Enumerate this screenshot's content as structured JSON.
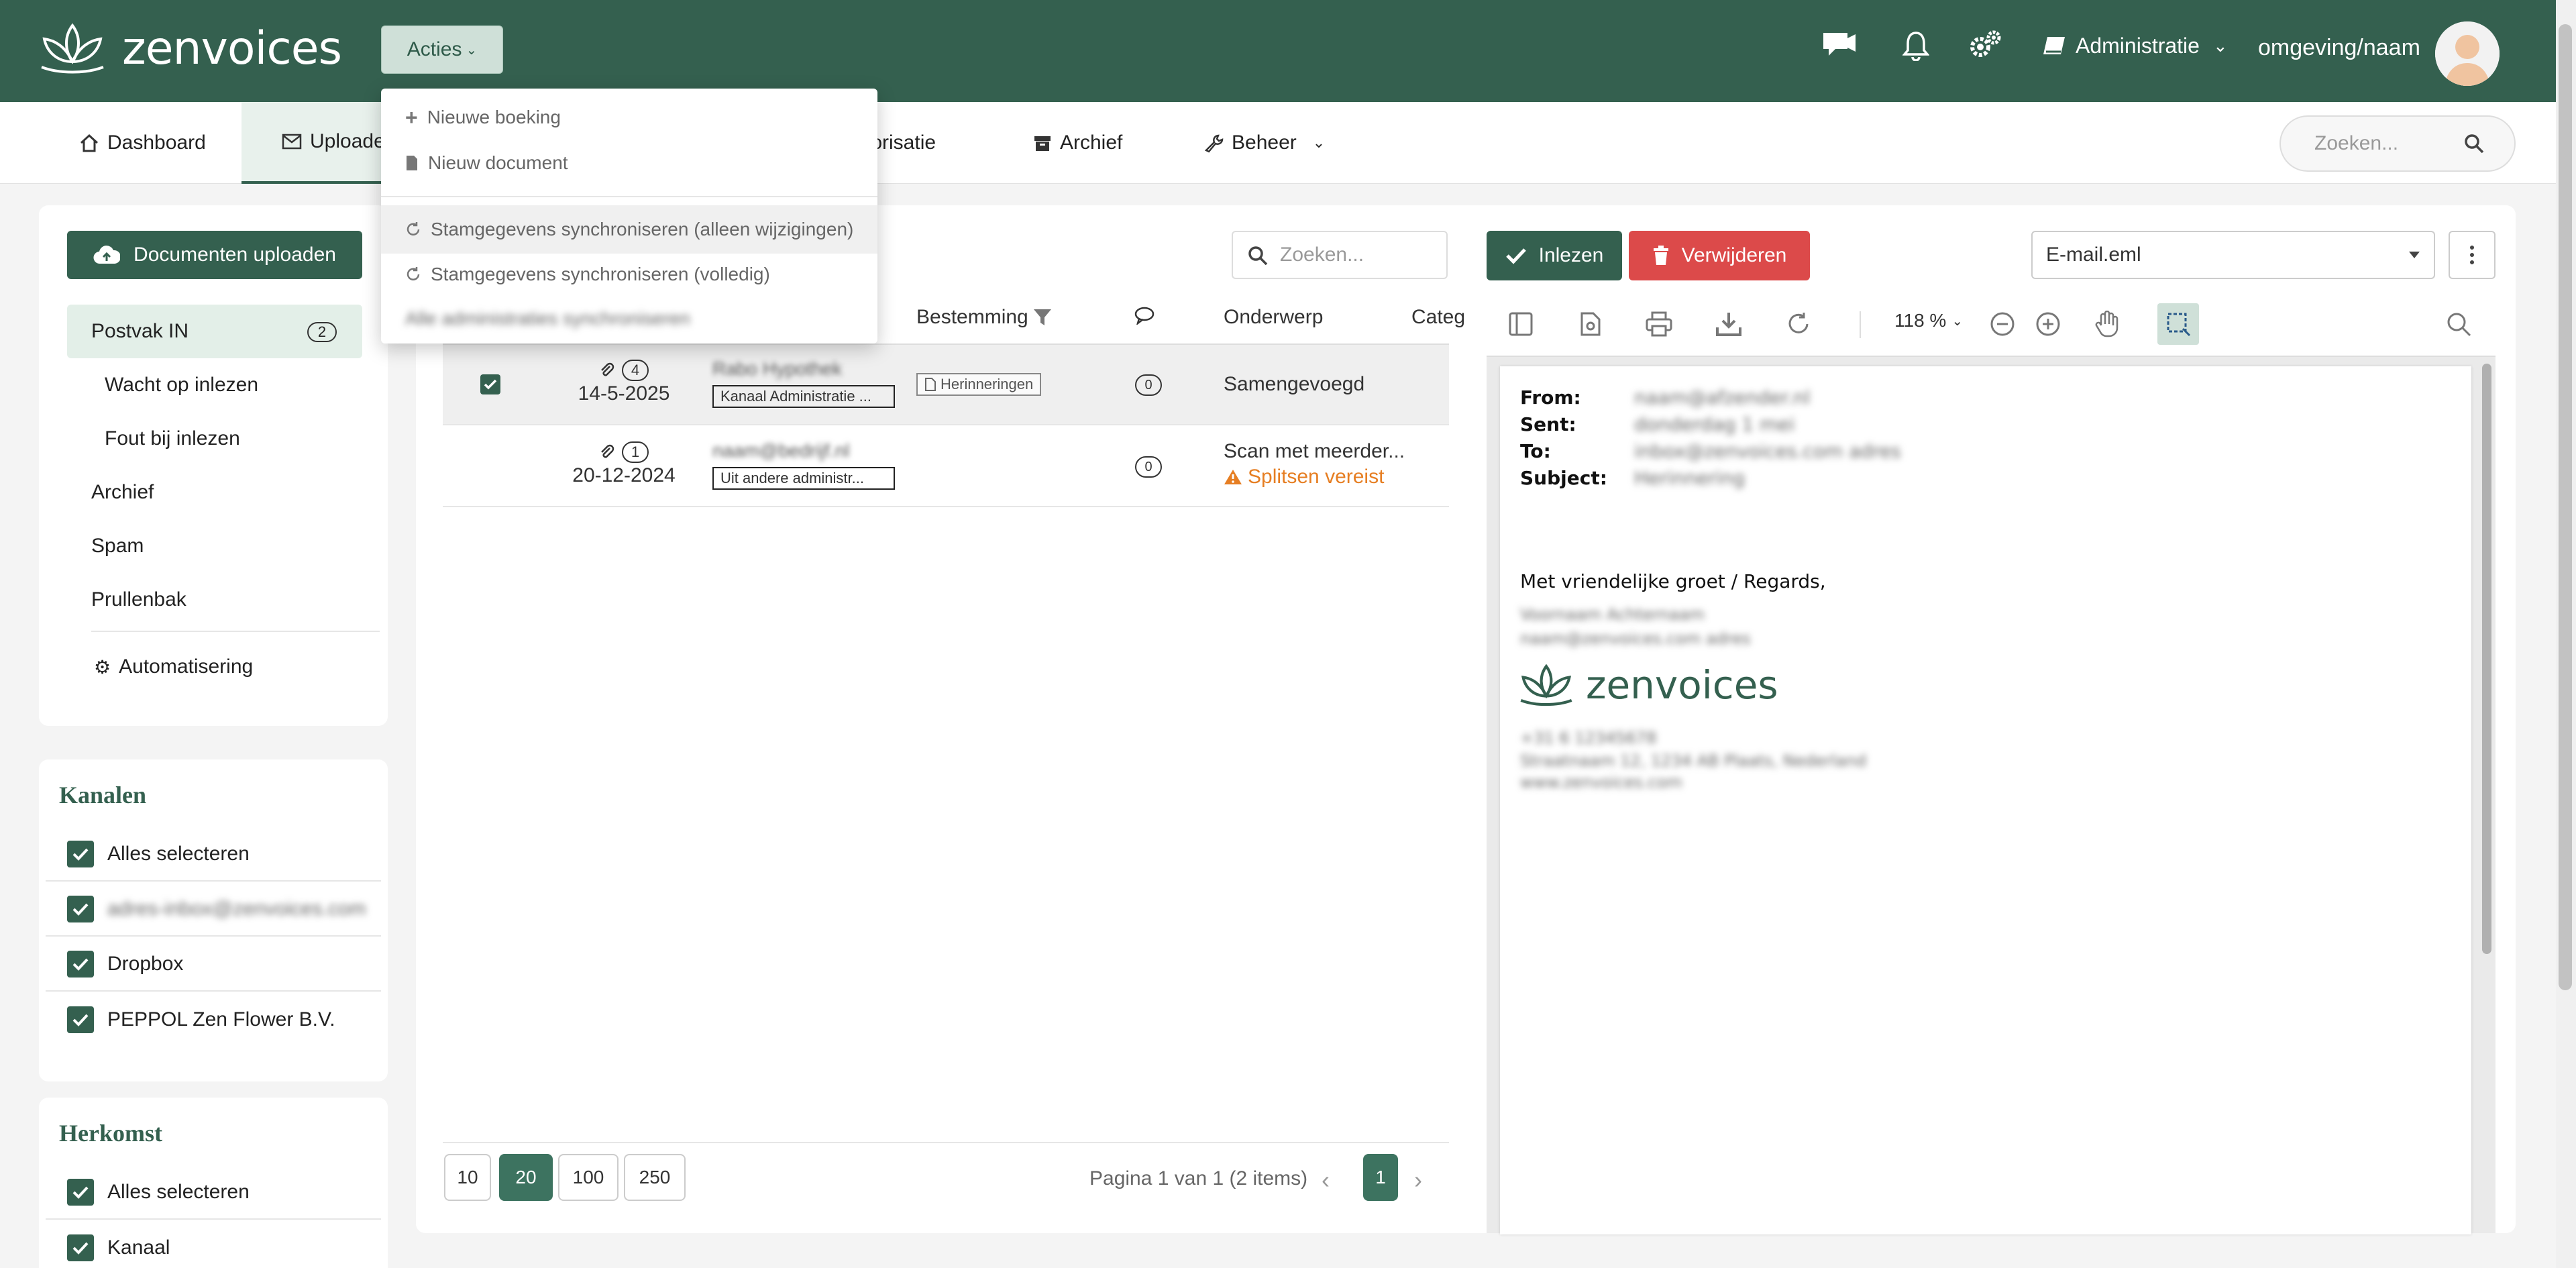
{
  "app": {
    "logo_text": "zenvoices",
    "acties_label": "Acties",
    "admin_label": "Administratie",
    "user_label": "omgeving/naam"
  },
  "nav": {
    "items": [
      "Dashboard",
      "Uploaden",
      "torisatie",
      "Archief",
      "Beheer"
    ],
    "search_placeholder": "Zoeken..."
  },
  "acties_menu": {
    "items": [
      "Nieuwe boeking",
      "Nieuw document",
      "Stamgegevens synchroniseren (alleen wijzigingen)",
      "Stamgegevens synchroniseren (volledig)",
      "Alle administraties synchroniseren"
    ]
  },
  "sidebar": {
    "upload_label": "Documenten uploaden",
    "folders": [
      "Postvak IN",
      "Wacht op inlezen",
      "Fout bij inlezen",
      "Archief",
      "Spam",
      "Prullenbak"
    ],
    "inbox_count": "2",
    "automation_label": "Automatisering"
  },
  "kanalen": {
    "title": "Kanalen",
    "items": [
      "Alles selecteren",
      "adres-inbox@zenvoices.com",
      "Dropbox",
      "PEPPOL Zen Flower B.V."
    ]
  },
  "herkomst": {
    "title": "Herkomst",
    "items": [
      "Alles selecteren",
      "Kanaal"
    ]
  },
  "list": {
    "search_placeholder": "Zoeken...",
    "columns": {
      "destination": "Bestemming",
      "subject": "Onderwerp",
      "category": "Categ"
    },
    "rows": [
      {
        "attachments": "4",
        "date": "14-5-2025",
        "sender": "Rabo Hypothek",
        "channel": "Kanaal Administratie ...",
        "destination": "Herinneringen",
        "comments": "0",
        "subject": "Samengevoegd",
        "warning": ""
      },
      {
        "attachments": "1",
        "date": "20-12-2024",
        "sender": "naam@bedrijf.nl",
        "channel": "Uit andere administr...",
        "destination": "",
        "comments": "0",
        "subject": "Scan met meerder...",
        "warning": "Splitsen vereist"
      }
    ],
    "page_sizes": [
      "10",
      "20",
      "100",
      "250"
    ],
    "page_info": "Pagina 1 van 1 (2 items)",
    "current_page": "1"
  },
  "viewer": {
    "inlezen_label": "Inlezen",
    "verwijderen_label": "Verwijderen",
    "file_name": "E-mail.eml",
    "zoom": "118 %",
    "email": {
      "from_label": "From:",
      "sent_label": "Sent:",
      "to_label": "To:",
      "subject_label": "Subject:",
      "from": "naam@afzender.nl",
      "sent": "donderdag 1 mei",
      "to": "inbox@zenvoices.com adres",
      "subject": "Herinnering",
      "greeting": "Met vriendelijke groet / Regards,",
      "sig_name": "Voornaam Achternaam",
      "sig_mail": "naam@zenvoices.com adres",
      "sig_logo": "zenvoices",
      "sig_extra1": "+31 6 12345678",
      "sig_extra2": "Straatnaam 12, 1234 AB Plaats, Nederland",
      "sig_extra3": "www.zenvoices.com"
    }
  },
  "colors": {
    "brand": "#34604f",
    "danger": "#dc4a4a",
    "warning": "#e67e22"
  }
}
